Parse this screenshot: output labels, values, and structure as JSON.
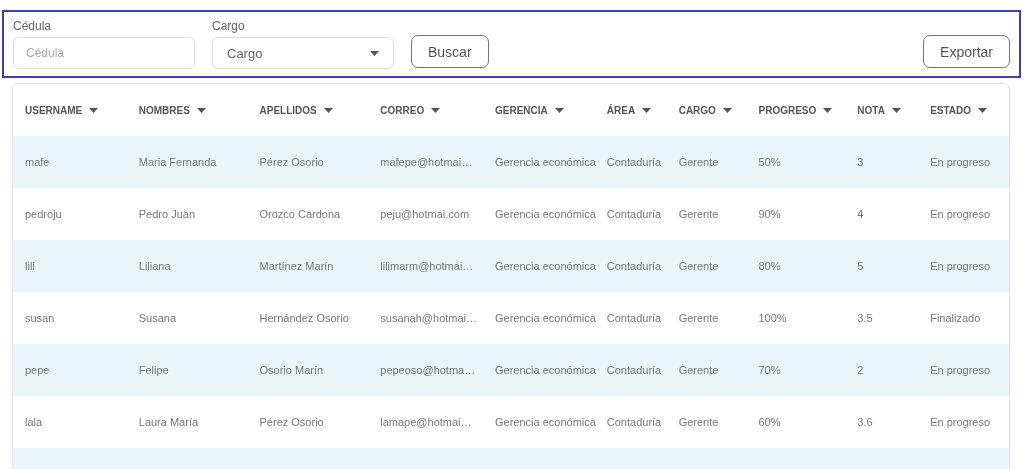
{
  "filters": {
    "fields": [
      {
        "kind": "input",
        "label": "Cédula",
        "placeholder": "Cédula"
      },
      {
        "kind": "select",
        "label": "Cargo",
        "placeholder": "Cargo"
      }
    ],
    "search_button": "Buscar",
    "export_button": "Exportar"
  },
  "table": {
    "columns": [
      "USERNAME",
      "NOMBRES",
      "APELLIDOS",
      "CORREO",
      "GERENCIA",
      "ÁREA",
      "CARGO",
      "PROGRESO",
      "NOTA",
      "ESTADO"
    ],
    "rows": [
      [
        "mafe",
        "Maria Fernanda",
        "Pérez Osorio",
        "mafepe@hotmai…",
        "Gerencia económica",
        "Contaduría",
        "Gerente",
        "50%",
        "3",
        "En progreso"
      ],
      [
        "pedroju",
        "Pedro Juan",
        "Orozco Cardona",
        "peju@hotmai.com",
        "Gerencia económica",
        "Contaduría",
        "Gerente",
        "90%",
        "4",
        "En progreso"
      ],
      [
        "lili",
        "Liliana",
        "Martínez Marín",
        "lilimarm@hotmai…",
        "Gerencia económica",
        "Contaduría",
        "Gerente",
        "80%",
        "5",
        "En progreso"
      ],
      [
        "susan",
        "Susana",
        "Hernández Osorio",
        "susanah@hotmai…",
        "Gerencia económica",
        "Contaduría",
        "Gerente",
        "100%",
        "3.5",
        "Finalizado"
      ],
      [
        "pepe",
        "Felipe",
        "Osorio Marín",
        "pepeoso@hotma…",
        "Gerencia económica",
        "Contaduría",
        "Gerente",
        "70%",
        "2",
        "En progreso"
      ],
      [
        "lala",
        "Laura María",
        "Pérez Osorio",
        "lamape@hotmai…",
        "Gerencia económica",
        "Contaduría",
        "Gerente",
        "60%",
        "3.6",
        "En progreso"
      ]
    ]
  }
}
